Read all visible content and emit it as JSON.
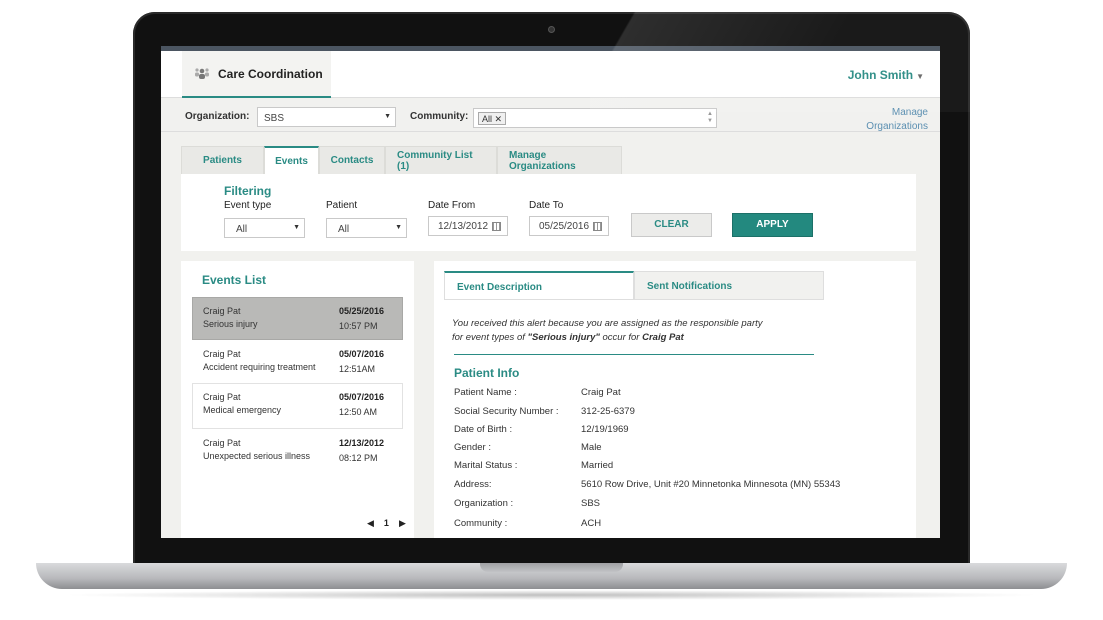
{
  "app": {
    "title": "Care Coordination",
    "user": "John Smith"
  },
  "orgbar": {
    "org_label": "Organization:",
    "org_value": "SBS",
    "community_label": "Community:",
    "community_tag": "All",
    "manage_line1": "Manage",
    "manage_line2": "Organizations"
  },
  "tabs": [
    "Patients",
    "Events",
    "Contacts",
    "Community List (1)",
    "Manage Organizations"
  ],
  "active_tab": "Events",
  "filter": {
    "heading": "Filtering",
    "event_type_label": "Event type",
    "event_type_value": "All",
    "patient_label": "Patient",
    "patient_value": "All",
    "date_from_label": "Date From",
    "date_from_value": "12/13/2012",
    "date_to_label": "Date To",
    "date_to_value": "05/25/2016",
    "clear_label": "CLEAR",
    "apply_label": "APPLY"
  },
  "events": {
    "heading": "Events List",
    "items": [
      {
        "name": "Craig Pat",
        "type": "Serious injury",
        "date": "05/25/2016",
        "time": "10:57 PM",
        "selected": true
      },
      {
        "name": "Craig Pat",
        "type": "Accident requiring treatment",
        "date": "05/07/2016",
        "time": "12:51AM",
        "selected": false
      },
      {
        "name": "Craig Pat",
        "type": "Medical emergency",
        "date": "05/07/2016",
        "time": "12:50 AM",
        "selected": false
      },
      {
        "name": "Craig Pat",
        "type": "Unexpected serious illness",
        "date": "12/13/2012",
        "time": "08:12 PM",
        "selected": false
      }
    ],
    "page": "1"
  },
  "detail": {
    "tab_description": "Event Description",
    "tab_notifications": "Sent Notifications",
    "note_line1": "You received this alert because you are assigned as the responsible party",
    "note_line2_prefix": "for event types of ",
    "note_event": "\"Serious injury\"",
    "note_mid": " occur for ",
    "note_patient": "Craig Pat",
    "section_title": "Patient Info",
    "fields": [
      {
        "label": "Patient Name :",
        "value": "Craig Pat"
      },
      {
        "label": "Social Security Number :",
        "value": "312-25-6379"
      },
      {
        "label": "Date of Birth :",
        "value": "12/19/1969"
      },
      {
        "label": "Gender :",
        "value": "Male"
      },
      {
        "label": "Marital Status :",
        "value": "Married"
      },
      {
        "label": "Address:",
        "value": "5610 Row Drive, Unit #20  Minnetonka Minnesota (MN) 55343"
      },
      {
        "label": "Organization :",
        "value": "SBS"
      },
      {
        "label": "Community :",
        "value": "ACH"
      }
    ]
  },
  "colors": {
    "accent": "#2a8b84",
    "apply_button": "#23897f",
    "selected_row": "#b9b9b7"
  }
}
